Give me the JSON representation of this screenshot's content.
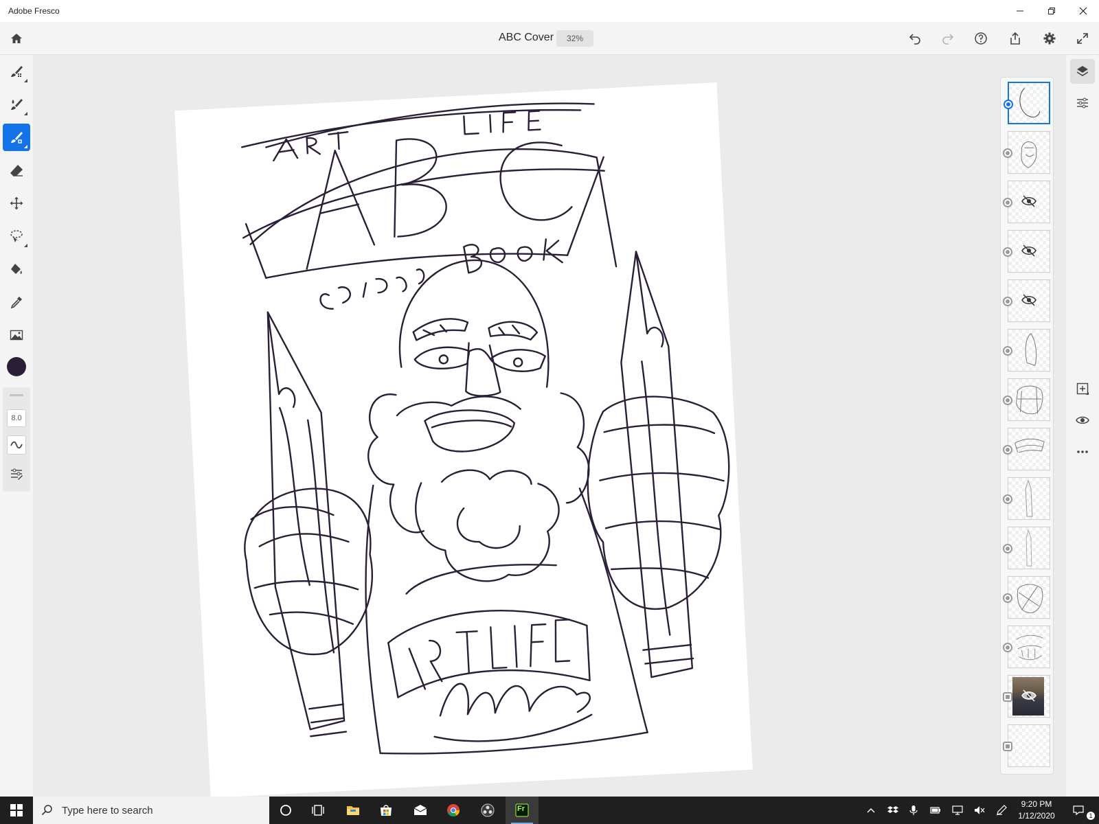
{
  "window": {
    "app_title": "Adobe Fresco",
    "minimize_icon": "minimize-icon",
    "restore_icon": "restore-icon",
    "close_icon": "close-icon"
  },
  "header": {
    "home_icon": "home-icon",
    "doc_title": "ABC Cover",
    "zoom": "32%",
    "actions": [
      "undo-icon",
      "redo-icon",
      "help-icon",
      "share-icon",
      "settings-gear-icon",
      "fullscreen-icon"
    ]
  },
  "tools": [
    {
      "name": "pixel-brush",
      "icon": "pixel-brush-icon",
      "active": false
    },
    {
      "name": "live-brush",
      "icon": "live-brush-icon",
      "active": false
    },
    {
      "name": "vector-brush",
      "icon": "vector-brush-icon",
      "active": true
    },
    {
      "name": "eraser",
      "icon": "eraser-icon",
      "active": false
    },
    {
      "name": "transform",
      "icon": "move-transform-icon",
      "active": false
    },
    {
      "name": "selection",
      "icon": "lasso-icon",
      "active": false
    },
    {
      "name": "fill",
      "icon": "paint-bucket-icon",
      "active": false
    },
    {
      "name": "eyedropper",
      "icon": "eyedropper-icon",
      "active": false
    },
    {
      "name": "place-image",
      "icon": "image-icon",
      "active": false
    }
  ],
  "current_color": "#2a1f36",
  "brush_settings": {
    "size": "8.0",
    "smoothing_icon": "smoothing-wave-icon",
    "settings_icon": "brush-settings-icon"
  },
  "layers": [
    {
      "index": 1,
      "selected": true,
      "hidden": false,
      "type": "vector"
    },
    {
      "index": 2,
      "selected": false,
      "hidden": false,
      "type": "vector"
    },
    {
      "index": 3,
      "selected": false,
      "hidden": true,
      "type": "vector"
    },
    {
      "index": 4,
      "selected": false,
      "hidden": true,
      "type": "vector"
    },
    {
      "index": 5,
      "selected": false,
      "hidden": true,
      "type": "vector"
    },
    {
      "index": 6,
      "selected": false,
      "hidden": false,
      "type": "vector"
    },
    {
      "index": 7,
      "selected": false,
      "hidden": false,
      "type": "vector"
    },
    {
      "index": 8,
      "selected": false,
      "hidden": false,
      "type": "vector"
    },
    {
      "index": 9,
      "selected": false,
      "hidden": false,
      "type": "vector"
    },
    {
      "index": 10,
      "selected": false,
      "hidden": false,
      "type": "vector"
    },
    {
      "index": 11,
      "selected": false,
      "hidden": false,
      "type": "vector"
    },
    {
      "index": 12,
      "selected": false,
      "hidden": false,
      "type": "vector"
    },
    {
      "index": 13,
      "selected": false,
      "hidden": true,
      "type": "image"
    },
    {
      "index": 14,
      "selected": false,
      "hidden": false,
      "type": "image"
    }
  ],
  "right_rail": [
    "layers-icon",
    "layer-properties-icon",
    "add-layer-icon",
    "visibility-eye-icon",
    "more-options-icon"
  ],
  "taskbar": {
    "search_placeholder": "Type here to search",
    "apps": [
      "start-icon",
      "cortana-icon",
      "task-view-icon",
      "file-explorer-icon",
      "store-icon",
      "mail-icon",
      "chrome-icon",
      "obs-icon",
      "fresco-app-icon"
    ],
    "fresco_label": "Fr",
    "tray": [
      "chevron-up-icon",
      "dropbox-icon",
      "microphone-icon",
      "battery-icon",
      "network-icon",
      "mute-icon",
      "pen-icon"
    ],
    "time": "9:20 PM",
    "date": "1/12/2020",
    "notification_count": "1"
  },
  "colors": {
    "accent": "#1473e6",
    "ink": "#2a1f36",
    "taskbar": "#1f1f1f"
  }
}
